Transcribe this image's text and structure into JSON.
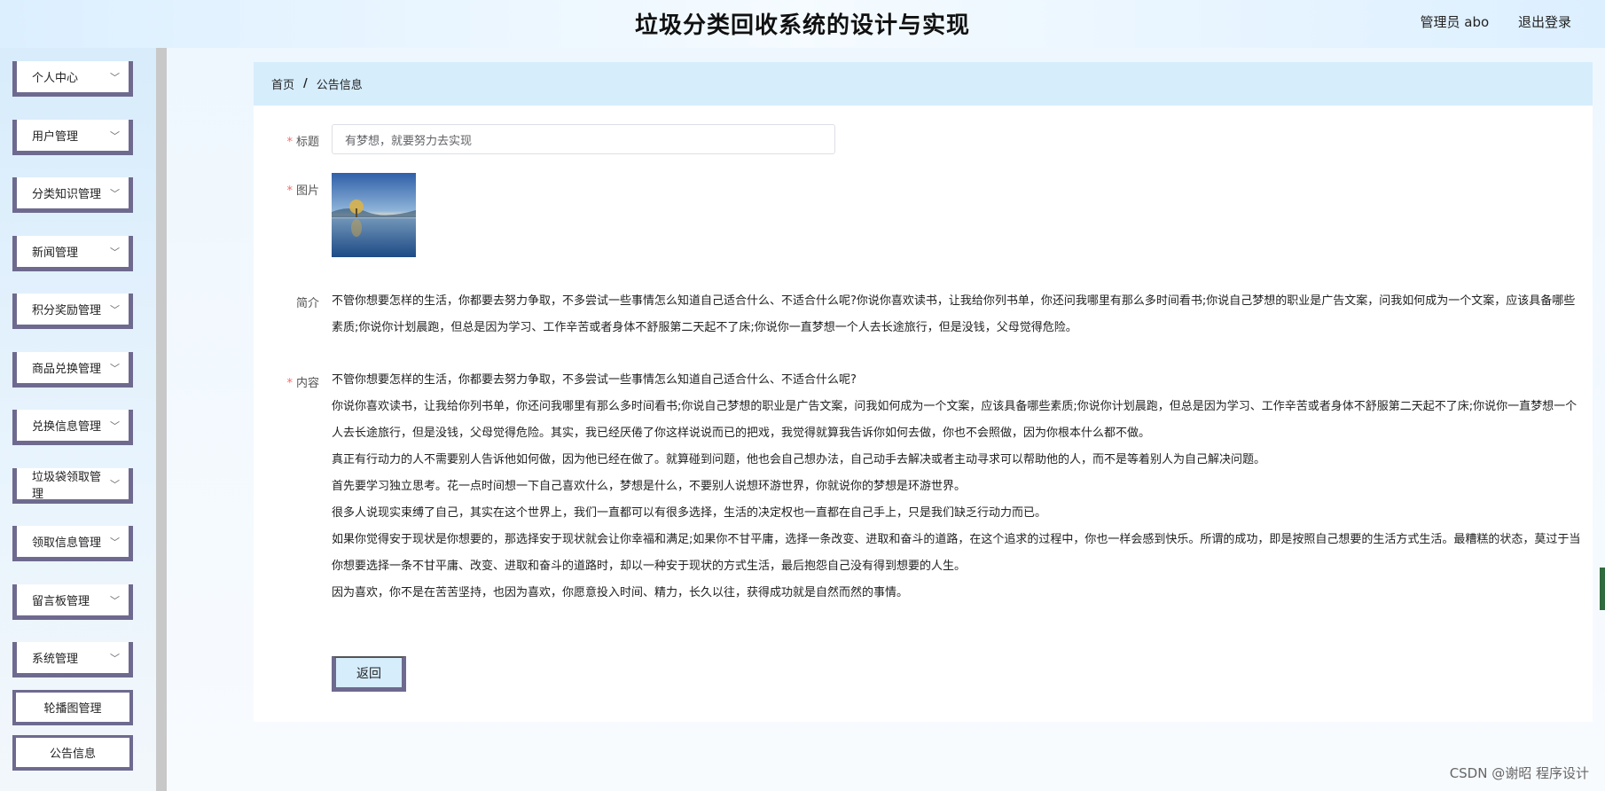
{
  "header": {
    "title": "垃圾分类回收系统的设计与实现",
    "user_label": "管理员 abo",
    "logout_label": "退出登录"
  },
  "sidebar": {
    "items": [
      {
        "label": "个人中心"
      },
      {
        "label": "用户管理"
      },
      {
        "label": "分类知识管理"
      },
      {
        "label": "新闻管理"
      },
      {
        "label": "积分奖励管理"
      },
      {
        "label": "商品兑换管理"
      },
      {
        "label": "兑换信息管理"
      },
      {
        "label": "垃圾袋领取管理"
      },
      {
        "label": "领取信息管理"
      },
      {
        "label": "留言板管理"
      },
      {
        "label": "系统管理"
      }
    ],
    "sub_items": [
      {
        "label": "轮播图管理"
      },
      {
        "label": "公告信息"
      }
    ],
    "chevron": "chevron-down-icon"
  },
  "breadcrumb": {
    "home": "首页",
    "separator": "/",
    "current": "公告信息"
  },
  "form": {
    "title_label": "标题",
    "title_value": "有梦想，就要努力去实现",
    "image_label": "图片",
    "intro_label": "简介",
    "intro_text": "不管你想要怎样的生活，你都要去努力争取，不多尝试一些事情怎么知道自己适合什么、不适合什么呢?你说你喜欢读书，让我给你列书单，你还问我哪里有那么多时间看书;你说自己梦想的职业是广告文案，问我如何成为一个文案，应该具备哪些素质;你说你计划晨跑，但总是因为学习、工作辛苦或者身体不舒服第二天起不了床;你说你一直梦想一个人去长途旅行，但是没钱，父母觉得危险。",
    "content_label": "内容",
    "content_paragraphs": [
      "不管你想要怎样的生活，你都要去努力争取，不多尝试一些事情怎么知道自己适合什么、不适合什么呢?",
      "你说你喜欢读书，让我给你列书单，你还问我哪里有那么多时间看书;你说自己梦想的职业是广告文案，问我如何成为一个文案，应该具备哪些素质;你说你计划晨跑，但总是因为学习、工作辛苦或者身体不舒服第二天起不了床;你说你一直梦想一个人去长途旅行，但是没钱，父母觉得危险。其实，我已经厌倦了你这样说说而已的把戏，我觉得就算我告诉你如何去做，你也不会照做，因为你根本什么都不做。",
      "真正有行动力的人不需要别人告诉他如何做，因为他已经在做了。就算碰到问题，他也会自己想办法，自己动手去解决或者主动寻求可以帮助他的人，而不是等着别人为自己解决问题。",
      "首先要学习独立思考。花一点时间想一下自己喜欢什么，梦想是什么，不要别人说想环游世界，你就说你的梦想是环游世界。",
      "很多人说现实束缚了自己，其实在这个世界上，我们一直都可以有很多选择，生活的决定权也一直都在自己手上，只是我们缺乏行动力而已。",
      "如果你觉得安于现状是你想要的，那选择安于现状就会让你幸福和满足;如果你不甘平庸，选择一条改变、进取和奋斗的道路，在这个追求的过程中，你也一样会感到快乐。所谓的成功，即是按照自己想要的生活方式生活。最糟糕的状态，莫过于当你想要选择一条不甘平庸、改变、进取和奋斗的道路时，却以一种安于现状的方式生活，最后抱怨自己没有得到想要的人生。",
      "因为喜欢，你不是在苦苦坚持，也因为喜欢，你愿意投入时间、精力，长久以往，获得成功就是自然而然的事情。"
    ],
    "required_mark": "*",
    "back_label": "返回"
  },
  "watermark": "CSDN @谢昭  程序设计",
  "colors": {
    "accent_border": "#6e6a8f",
    "breadcrumb_bg": "#d6edfc",
    "required": "#f56c6c"
  }
}
